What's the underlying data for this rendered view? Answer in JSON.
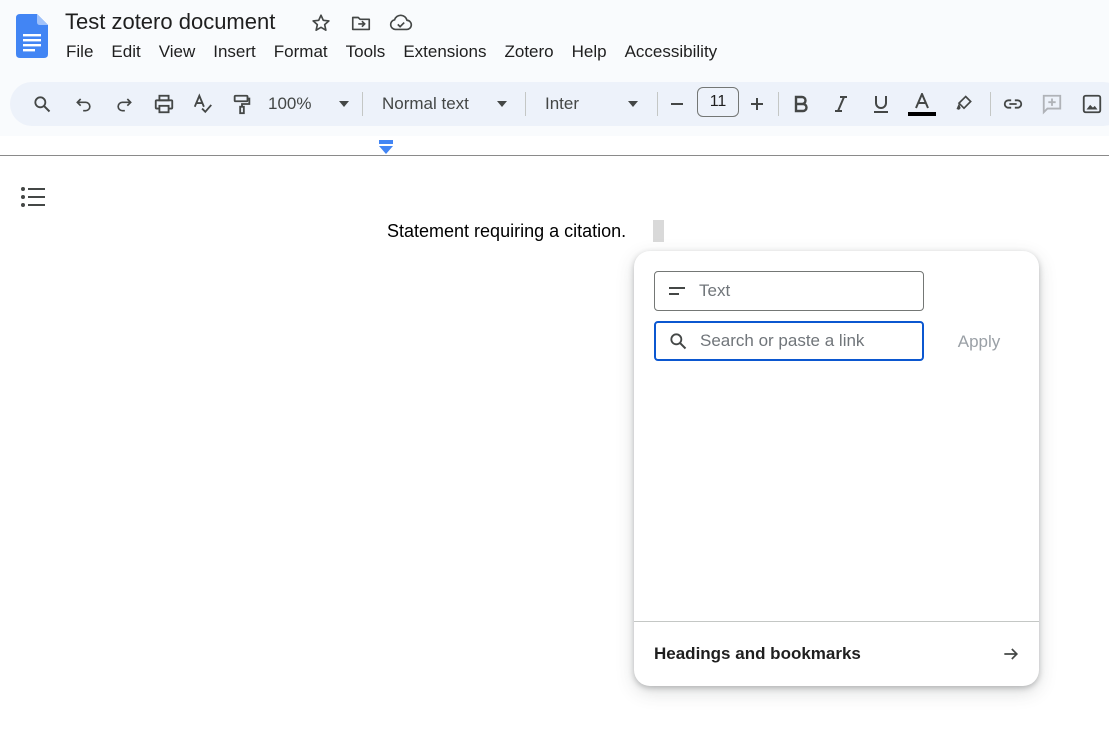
{
  "document": {
    "title": "Test zotero document",
    "body_text": "Statement requiring a citation."
  },
  "menu": [
    "File",
    "Edit",
    "View",
    "Insert",
    "Format",
    "Tools",
    "Extensions",
    "Zotero",
    "Help",
    "Accessibility"
  ],
  "toolbar": {
    "zoom": "100%",
    "style": "Normal text",
    "font": "Inter",
    "font_size": "11",
    "text_color": "#000000"
  },
  "link_popup": {
    "text_placeholder": "Text",
    "link_placeholder": "Search or paste a link",
    "apply_label": "Apply",
    "headings_label": "Headings and bookmarks"
  },
  "colors": {
    "accent": "#0b57d0",
    "docs_blue": "#4285f4"
  },
  "icons": [
    "docs-logo-icon",
    "star-icon",
    "move-folder-icon",
    "cloud-saved-icon",
    "search-icon",
    "undo-icon",
    "redo-icon",
    "print-icon",
    "spellcheck-icon",
    "paint-format-icon",
    "dropdown-arrow-icon",
    "minus-icon",
    "plus-icon",
    "bold-icon",
    "italic-icon",
    "underline-icon",
    "text-color-icon",
    "highlight-icon",
    "link-icon",
    "add-comment-icon",
    "image-icon",
    "outline-icon",
    "short-text-icon",
    "arrow-right-icon"
  ]
}
